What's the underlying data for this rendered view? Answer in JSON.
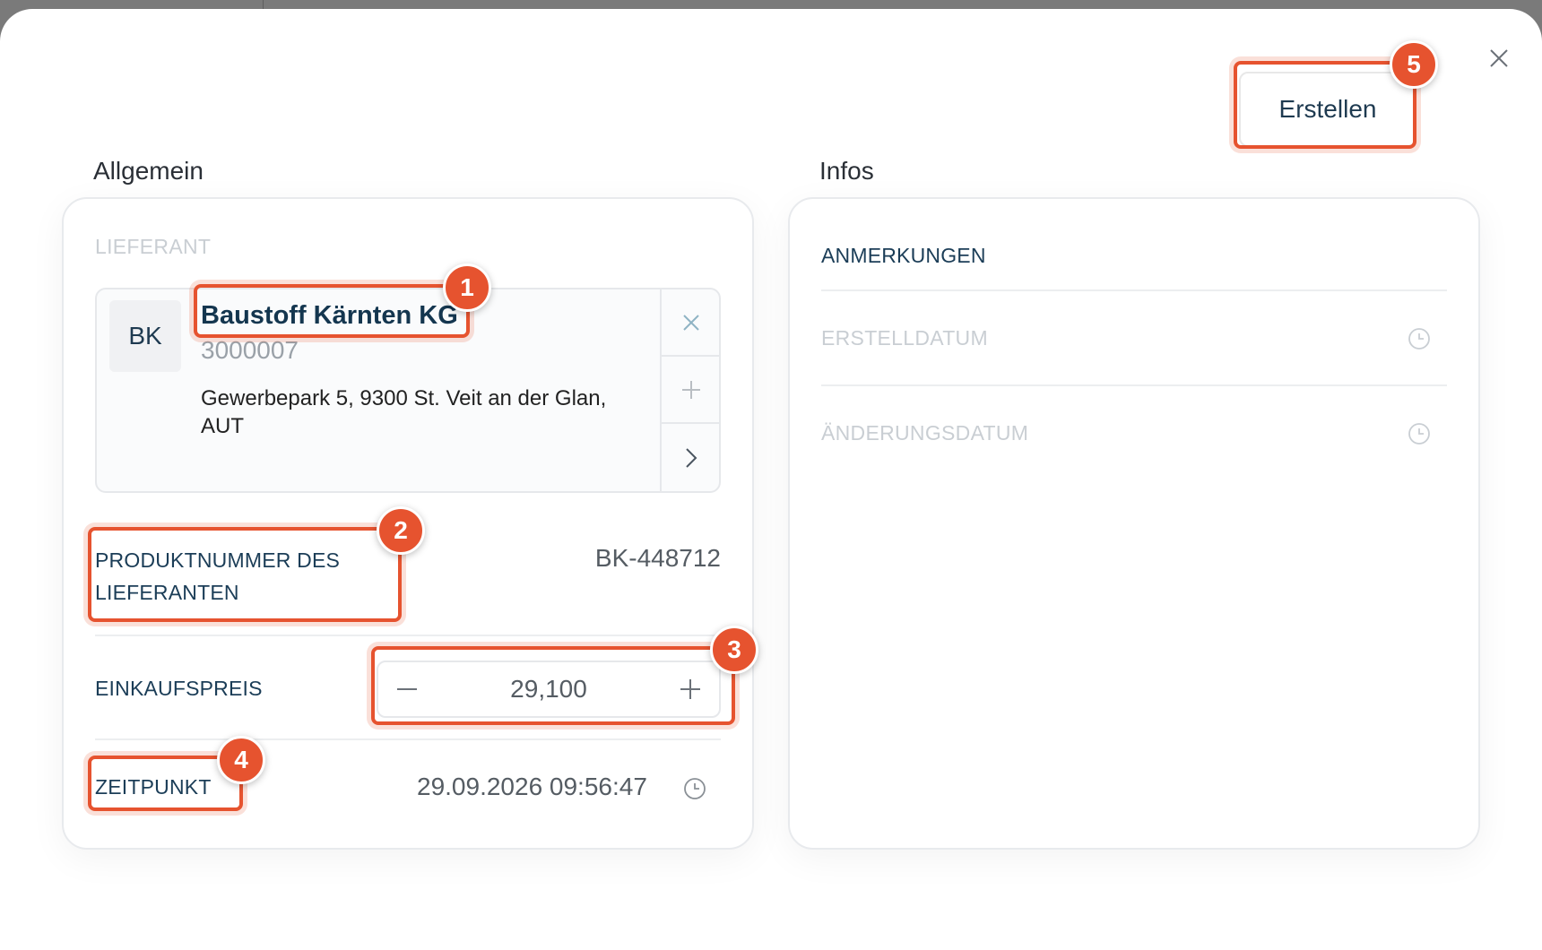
{
  "header": {
    "create_label": "Erstellen",
    "close_icon": "close-icon"
  },
  "general": {
    "title": "Allgemein",
    "supplier_label": "LIEFERANT",
    "supplier": {
      "initials": "BK",
      "name": "Baustoff Kärnten KG",
      "id": "3000007",
      "address": "Gewerbepark 5, 9300 St. Veit an der Glan, AUT"
    },
    "product_number_label": "PRODUKTNUMMER DES LIEFERANTEN",
    "product_number_value": "BK-448712",
    "price_label": "EINKAUFSPREIS",
    "price_value": "29,100",
    "time_label": "ZEITPUNKT",
    "time_value": "29.09.2026 09:56:47"
  },
  "info": {
    "title": "Infos",
    "notes_label": "ANMERKUNGEN",
    "created_label": "ERSTELLDATUM",
    "modified_label": "ÄNDERUNGSDATUM"
  },
  "annotations": {
    "color": "#e6532f",
    "badges": [
      "1",
      "2",
      "3",
      "4",
      "5"
    ]
  }
}
